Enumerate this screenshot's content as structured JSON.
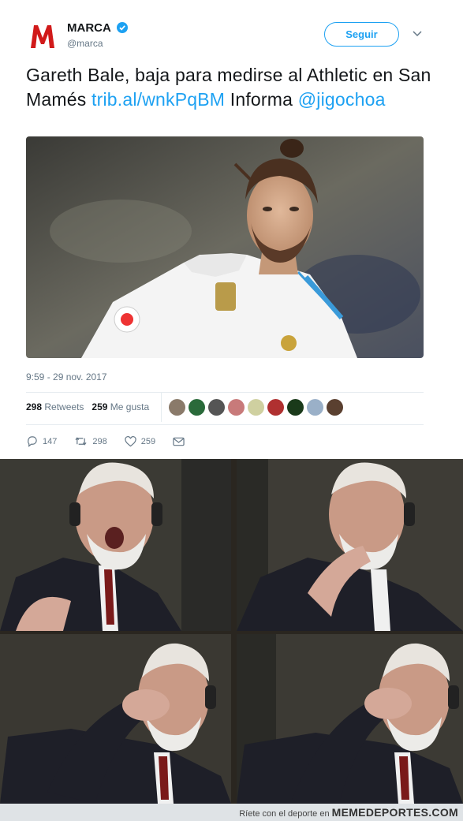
{
  "account": {
    "name": "MARCA",
    "handle": "@marca",
    "logo_letter": "M"
  },
  "follow_button": "Seguir",
  "tweet": {
    "text_part1": "Gareth Bale, baja para medirse al Athletic en San Mamés ",
    "link1": "trib.al/wnkPqBM",
    "text_part2": " Informa ",
    "link2": "@jigochoa"
  },
  "timestamp": "9:59 - 29 nov. 2017",
  "stats": {
    "retweets_count": "298",
    "retweets_label": "Retweets",
    "likes_count": "259",
    "likes_label": "Me gusta"
  },
  "actions": {
    "replies": "147",
    "retweets": "298",
    "likes": "259"
  },
  "footer": {
    "prefix": "Ríete con el deporte en",
    "brand": "MEMEDEPORTES.COM"
  },
  "colors": {
    "accent": "#1da1f2",
    "marca_red": "#d11a1a"
  }
}
